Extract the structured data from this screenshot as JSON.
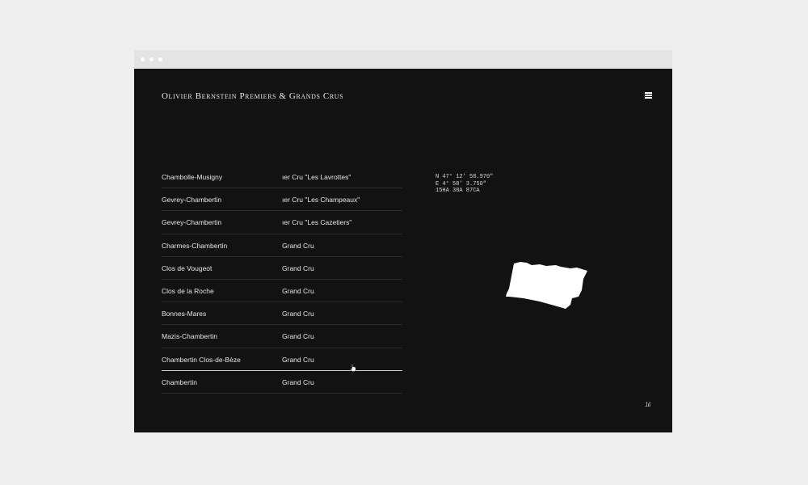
{
  "site": {
    "title": "Olivier Bernstein Premiers & Grands Crus",
    "logo_mark": ".lıl"
  },
  "vineyards": [
    {
      "name": "Chambolle-Musigny",
      "classification": "ıer Cru \"Les Lavrottes\""
    },
    {
      "name": "Gevrey-Chambertin",
      "classification": "ıer Cru \"Les Champeaux\""
    },
    {
      "name": "Gevrey-Chambertin",
      "classification": "ıer Cru \"Les Cazetiers\""
    },
    {
      "name": "Charmes-Chambertin",
      "classification": "Grand Cru"
    },
    {
      "name": "Clos de Vougeot",
      "classification": "Grand Cru"
    },
    {
      "name": "Clos de la Roche",
      "classification": "Grand Cru"
    },
    {
      "name": "Bonnes-Mares",
      "classification": "Grand Cru"
    },
    {
      "name": "Mazis-Chambertin",
      "classification": "Grand Cru"
    },
    {
      "name": "Chambertin Clos-de-Bèze",
      "classification": "Grand Cru"
    },
    {
      "name": "Chambertin",
      "classification": "Grand Cru"
    }
  ],
  "details": {
    "latitude": "N 47° 12' 58.970\"",
    "longitude": "E 4° 58' 3.750\"",
    "area": "15HA 38A 87CA"
  },
  "colors": {
    "background": "#121212",
    "text": "#ffffff",
    "divider": "#2c2c2c",
    "active_divider": "#cfcfcf"
  },
  "icons": {
    "menu": "hamburger-icon",
    "cursor": "hand-pointer-icon"
  }
}
